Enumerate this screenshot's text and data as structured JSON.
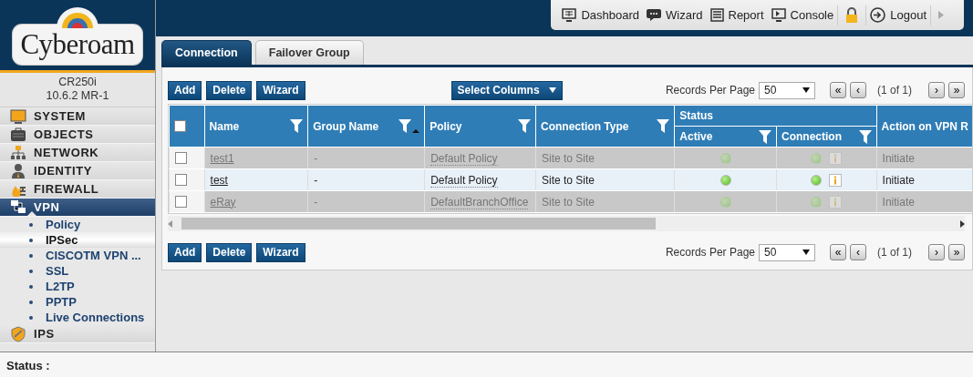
{
  "brand": {
    "logo_text": "Cyberoam"
  },
  "device": {
    "model": "CR250i",
    "version": "10.6.2 MR-1"
  },
  "top_toolbar": [
    {
      "kind": "dashboard",
      "label": "Dashboard"
    },
    {
      "kind": "wizard",
      "label": "Wizard"
    },
    {
      "kind": "report",
      "label": "Report"
    },
    {
      "kind": "console",
      "label": "Console"
    },
    {
      "kind": "lock"
    },
    {
      "kind": "logout",
      "label": "Logout"
    },
    {
      "kind": "more"
    }
  ],
  "sidebar": {
    "items": [
      {
        "kind": "system",
        "label": "SYSTEM",
        "selected": false
      },
      {
        "kind": "objects",
        "label": "OBJECTS",
        "selected": false
      },
      {
        "kind": "network",
        "label": "NETWORK",
        "selected": false
      },
      {
        "kind": "identity",
        "label": "IDENTITY",
        "selected": false
      },
      {
        "kind": "firewall",
        "label": "FIREWALL",
        "selected": false
      },
      {
        "kind": "vpn",
        "label": "VPN",
        "selected": true,
        "expanded": true,
        "children": [
          {
            "label": "Policy",
            "selected": false
          },
          {
            "label": "IPSec",
            "selected": true
          },
          {
            "label": "CISCOTM VPN ...",
            "selected": false
          },
          {
            "label": "SSL",
            "selected": false
          },
          {
            "label": "L2TP",
            "selected": false
          },
          {
            "label": "PPTP",
            "selected": false
          },
          {
            "label": "Live Connections",
            "selected": false
          }
        ]
      },
      {
        "kind": "ips",
        "label": "IPS",
        "selected": false
      }
    ]
  },
  "tabs": [
    {
      "label": "Connection",
      "selected": true
    },
    {
      "label": "Failover Group",
      "selected": false
    }
  ],
  "top_actions": {
    "buttons": [
      "Add",
      "Delete",
      "Wizard"
    ],
    "select_columns": "Select Columns",
    "records_label": "Records Per Page",
    "records_value": "50",
    "pager": [
      "«",
      "‹",
      "(1 of 1)",
      "›",
      "»"
    ]
  },
  "table": {
    "header_checked": false,
    "columns": [
      {
        "label": "Name",
        "filter": true,
        "sorted": false
      },
      {
        "label": "Group Name",
        "filter": true,
        "sorted": true
      },
      {
        "label": "Policy",
        "filter": true,
        "sorted": false
      },
      {
        "label": "Connection Type",
        "filter": true,
        "sorted": false
      },
      {
        "label": "Status",
        "children": [
          {
            "label": "Active",
            "filter": true,
            "sorted": false
          },
          {
            "label": "Connection",
            "filter": true,
            "sorted": false
          }
        ]
      },
      {
        "label": "Action on VPN R"
      }
    ],
    "rows": [
      {
        "checked": false,
        "disabled": true,
        "name": "test1",
        "group": "-",
        "policy": "Default Policy",
        "type": "Site to Site",
        "active": true,
        "connected": true,
        "action": "Initiate"
      },
      {
        "checked": false,
        "disabled": false,
        "name": "test",
        "group": "-",
        "policy": "Default Policy",
        "type": "Site to Site",
        "active": true,
        "connected": true,
        "action": "Initiate"
      },
      {
        "checked": false,
        "disabled": true,
        "name": "eRay",
        "group": "-",
        "policy": "DefaultBranchOffice",
        "type": "Site to Site",
        "active": true,
        "connected": true,
        "action": "Initiate"
      }
    ]
  },
  "bottom_actions": {
    "buttons": [
      "Add",
      "Delete",
      "Wizard"
    ],
    "records_label": "Records Per Page",
    "records_value": "50",
    "pager": [
      "«",
      "‹",
      "(1 of 1)",
      "›",
      "»"
    ]
  },
  "status_bar": {
    "label": "Status :"
  }
}
